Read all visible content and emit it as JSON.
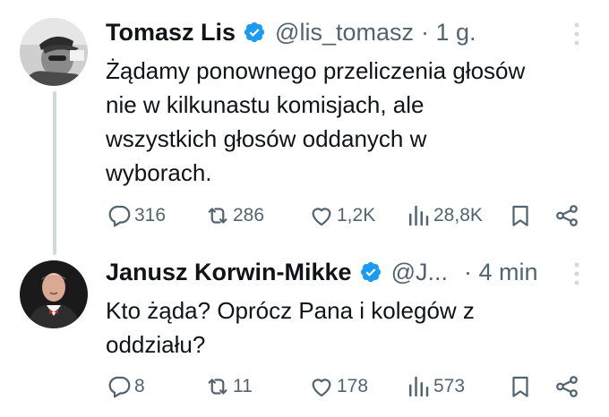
{
  "thread": [
    {
      "author": {
        "name": "Tomasz Lis",
        "handle": "@lis_tomasz",
        "verified": true,
        "verified_color": "#1d9bf0"
      },
      "time": "· 1 g.",
      "text_lines": [
        "Żądamy ponownego przeliczenia głosów",
        "nie w kilkunastu komisjach, ale",
        "wszystkich głosów oddanych w",
        "wyborach."
      ],
      "stats": {
        "replies": "316",
        "reposts": "286",
        "likes": "1,2K",
        "views": "28,8K"
      }
    },
    {
      "author": {
        "name": "Janusz Korwin-Mikke",
        "handle": "@J...",
        "verified": true,
        "verified_color": "#1d9bf0"
      },
      "time": "· 4 min",
      "text_lines": [
        "Kto żąda? Oprócz Pana i kolegów z",
        "oddziału?"
      ],
      "stats": {
        "replies": "8",
        "reposts": "11",
        "likes": "178",
        "views": "573"
      }
    }
  ],
  "icons": {
    "reply": "reply-icon",
    "repost": "repost-icon",
    "like": "heart-icon",
    "views": "views-icon",
    "bookmark": "bookmark-icon",
    "share": "share-icon",
    "more": "more-icon"
  },
  "colors": {
    "text": "#0f1419",
    "muted": "#536471",
    "thread_line": "#cfd9de",
    "verified": "#1d9bf0"
  }
}
